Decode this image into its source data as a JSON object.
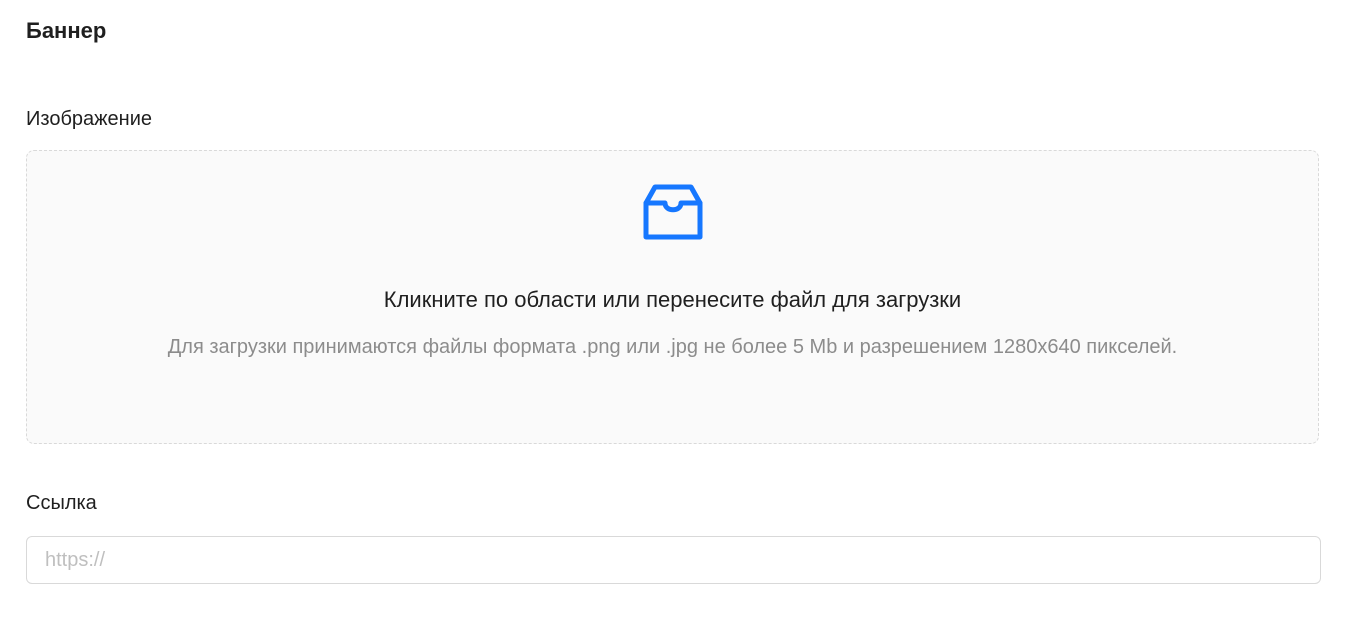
{
  "section": {
    "title": "Баннер"
  },
  "image_field": {
    "label": "Изображение",
    "icon": "inbox-icon",
    "accent_color": "#1677ff",
    "upload_text": "Кликните по области или перенесите файл для загрузки",
    "upload_hint": "Для загрузки принимаются файлы формата .png или .jpg не более 5 Mb и разрешением 1280x640 пикселей."
  },
  "link_field": {
    "label": "Ссылка",
    "value": "",
    "placeholder": "https://"
  }
}
